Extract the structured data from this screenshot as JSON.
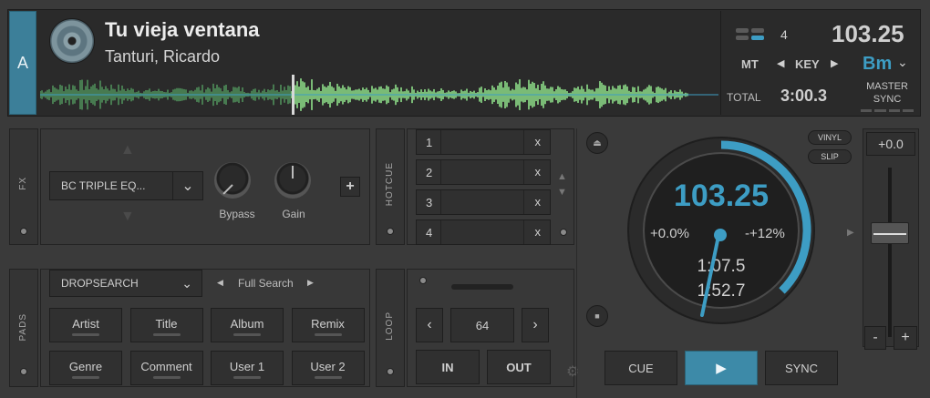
{
  "deck": {
    "letter": "A",
    "title": "Tu vieja ventana",
    "artist": "Tanturi, Ricardo",
    "bpm": "103.25",
    "pitch_range_num": "4",
    "mt_label": "MT",
    "key_label": "KEY",
    "key_value": "Bm",
    "total_label": "TOTAL",
    "total_time": "3:00.3",
    "master_sync": [
      "MASTER",
      "SYNC"
    ]
  },
  "fx": {
    "tab_label": "FX",
    "effect_name": "BC TRIPLE EQ...",
    "knobs": [
      {
        "label": "Bypass",
        "level": 0.15
      },
      {
        "label": "Gain",
        "level": 0.5
      }
    ],
    "add_label": "+"
  },
  "hotcue": {
    "tab_label": "HOTCUE",
    "slots": [
      {
        "num": "1",
        "clear": "x"
      },
      {
        "num": "2",
        "clear": "x"
      },
      {
        "num": "3",
        "clear": "x"
      },
      {
        "num": "4",
        "clear": "x"
      }
    ]
  },
  "pads": {
    "tab_label": "PADS",
    "search_mode": "DROPSEARCH",
    "search_scope": "Full Search",
    "buttons": [
      "Artist",
      "Title",
      "Album",
      "Remix",
      "Genre",
      "Comment",
      "User 1",
      "User 2"
    ]
  },
  "loop": {
    "tab_label": "LOOP",
    "size": "64",
    "in_label": "IN",
    "out_label": "OUT"
  },
  "jog": {
    "bpm": "103.25",
    "pitch_left": "+0.0%",
    "pitch_right": "-+12%",
    "elapsed": "1:07.5",
    "remaining": "1:52.7",
    "progress": 0.375
  },
  "transport": {
    "cue": "CUE",
    "play": "▶",
    "sync": "SYNC",
    "vinyl": "VINYL",
    "slip": "SLIP"
  },
  "pitch_fader": {
    "value": "+0.0",
    "minus": "-",
    "plus": "+"
  },
  "colors": {
    "accent": "#3d9dc4",
    "waveform_green": "#8ee08a",
    "waveform_dim": "#4f8f5a"
  }
}
